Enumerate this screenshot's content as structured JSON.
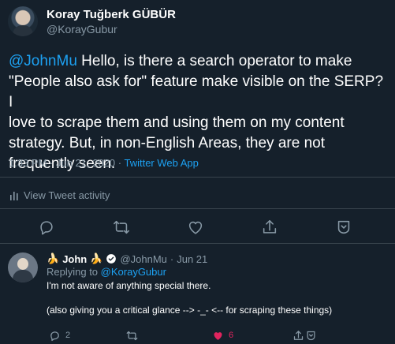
{
  "tweet": {
    "author_name": "Koray Tuğberk GÜBÜR",
    "author_handle": "@KorayGubur",
    "mention": "@JohnMu",
    "text_line1_rest": " Hello, is there a search operator to make",
    "text_line2": "\"People also ask for\" feature make visible on the SERP? I",
    "text_line3": "love to scrape them and using them on my content",
    "text_line4": "strategy. But, in non-English Areas, they are not",
    "text_line5": "frequently seen.",
    "timestamp": "1:33 PM · Jun 21, 2020 · ",
    "source": "Twitter Web App",
    "activity_label": "View Tweet activity",
    "actions": [
      "reply-icon",
      "retweet-icon",
      "like-icon",
      "share-icon",
      "analytics-icon"
    ]
  },
  "reply": {
    "name_prefix_emoji": "🍌",
    "name": "John",
    "name_suffix_emoji": "🍌",
    "handle": "@JohnMu",
    "dot": "·",
    "date": "Jun 21",
    "replying_prefix": "Replying to ",
    "replying_to": "@KorayGubur",
    "line1": "I'm not aware of anything special there.",
    "line2": "(also giving you a critical glance --> -_- <-- for scraping these things)",
    "reply_count": "2",
    "like_count": "6"
  },
  "colors": {
    "background": "#15202b",
    "accent": "#1da1f2",
    "muted": "#8899a6",
    "like": "#e0245e",
    "divider": "#38444d"
  }
}
